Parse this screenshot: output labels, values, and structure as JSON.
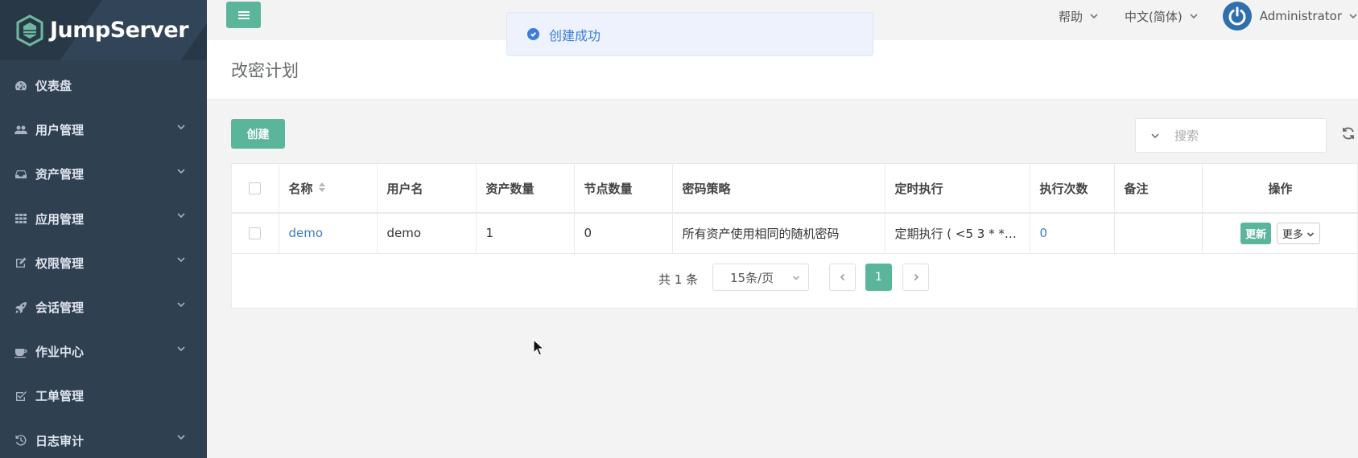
{
  "brand": {
    "name": "JumpServer"
  },
  "sidebar": {
    "items": [
      {
        "label": "仪表盘",
        "icon": "dashboard-icon",
        "expandable": false
      },
      {
        "label": "用户管理",
        "icon": "users-icon",
        "expandable": true
      },
      {
        "label": "资产管理",
        "icon": "inbox-icon",
        "expandable": true
      },
      {
        "label": "应用管理",
        "icon": "grid-icon",
        "expandable": true
      },
      {
        "label": "权限管理",
        "icon": "edit-icon",
        "expandable": true
      },
      {
        "label": "会话管理",
        "icon": "rocket-icon",
        "expandable": true
      },
      {
        "label": "作业中心",
        "icon": "coffee-icon",
        "expandable": true
      },
      {
        "label": "工单管理",
        "icon": "check-square-icon",
        "expandable": false
      },
      {
        "label": "日志审计",
        "icon": "history-icon",
        "expandable": true
      }
    ]
  },
  "topbar": {
    "help": "帮助",
    "language": "中文(简体)",
    "user": "Administrator"
  },
  "toast": {
    "message": "创建成功"
  },
  "page": {
    "title": "改密计划"
  },
  "toolbar": {
    "create_label": "创建",
    "search_placeholder": "搜索"
  },
  "table": {
    "columns": [
      "名称",
      "用户名",
      "资产数量",
      "节点数量",
      "密码策略",
      "定时执行",
      "执行次数",
      "备注",
      "操作"
    ],
    "rows": [
      {
        "name": "demo",
        "username": "demo",
        "asset_count": "1",
        "node_count": "0",
        "password_strategy": "所有资产使用相同的随机密码",
        "schedule": "定期执行 ( <5 3 * * ...",
        "exec_count": "0",
        "comment": "",
        "update_label": "更新",
        "more_label": "更多"
      }
    ]
  },
  "pagination": {
    "total": "共 1 条",
    "page_size": "15条/页",
    "current_page": "1"
  },
  "colors": {
    "sidebar": "#2f4050",
    "primary": "#5bb59a",
    "link": "#3e7dbf",
    "toast_text": "#3b7dd8"
  }
}
